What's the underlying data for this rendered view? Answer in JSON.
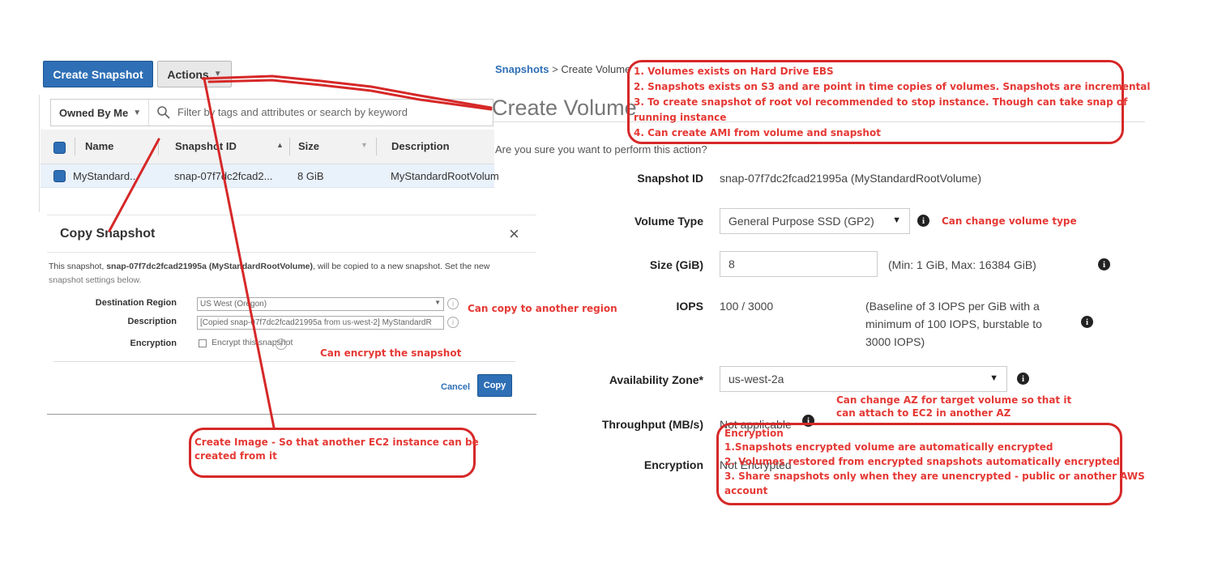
{
  "toolbar": {
    "create_snapshot": "Create Snapshot",
    "actions": "Actions",
    "chevron": "v"
  },
  "filter": {
    "owned_by": "Owned By Me",
    "placeholder": "Filter by tags and attributes or search by keyword"
  },
  "table": {
    "headers": [
      "Name",
      "Snapshot ID",
      "Size",
      "Description"
    ],
    "row": {
      "name": "MyStandard...",
      "snapshot_id": "snap-07f7dc2fcad2...",
      "size": "8 GiB",
      "description": "MyStandardRootVolum"
    }
  },
  "copy_modal": {
    "title": "Copy Snapshot",
    "close": "×",
    "message_prefix": "This snapshot, ",
    "message_bold": "snap-07f7dc2fcad21995a (MyStandardRootVolume)",
    "message_suffix": ", will be copied to a new snapshot. Set the new",
    "message_line2": "snapshot settings below.",
    "destination_label": "Destination Region",
    "destination_value": "US West (Oregon)",
    "description_label": "Description",
    "description_value": "[Copied snap-07f7dc2fcad21995a from us-west-2] MyStandardR",
    "encryption_label": "Encryption",
    "encryption_checkbox": "Encrypt this snapshot",
    "cancel": "Cancel",
    "copy": "Copy"
  },
  "create_volume": {
    "breadcrumb_link": "Snapshots",
    "breadcrumb_sep": ">",
    "breadcrumb_current": "Create Volume",
    "title": "Create Volume",
    "confirm": "Are you sure you want to perform this action?",
    "fields": {
      "snapshot_id_label": "Snapshot ID",
      "snapshot_id_value": "snap-07f7dc2fcad21995a (MyStandardRootVolume)",
      "volume_type_label": "Volume Type",
      "volume_type_value": "General Purpose SSD (GP2)",
      "size_label": "Size (GiB)",
      "size_value": "8",
      "size_hint": "(Min: 1 GiB, Max: 16384 GiB)",
      "iops_label": "IOPS",
      "iops_value": "100 / 3000",
      "iops_hint_1": "(Baseline of 3 IOPS per GiB with a",
      "iops_hint_2": "minimum of 100 IOPS, burstable to",
      "iops_hint_3": "3000 IOPS)",
      "az_label": "Availability Zone*",
      "az_value": "us-west-2a",
      "throughput_label": "Throughput (MB/s)",
      "throughput_value": "Not applicable",
      "encryption_label": "Encryption",
      "encryption_value": "Not Encrypted"
    }
  },
  "annotations": {
    "top_box": [
      "1. Volumes exists on Hard Drive EBS",
      "2. Snapshots exists on S3 and are point in time copies of volumes. Snapshots are incremental",
      "3. To create snapshot of root vol recommended to stop instance. Though can take snap of",
      "running instance",
      "4. Can create AMI from volume and snapshot"
    ],
    "volume_type": "Can change volume type",
    "copy_region": "Can copy to another region",
    "encrypt": "Can encrypt the snapshot",
    "az_1": "Can change AZ for target volume so that it",
    "az_2": "can attach to EC2 in another AZ",
    "create_image_1": "Create Image - So that another EC2 instance can be",
    "create_image_2": "created from it",
    "encryption_box": [
      "Encryption",
      "1.Snapshots encrypted volume are automatically encrypted",
      "2. Volumes restored from encrypted snapshots automatically encrypted",
      "3. Share snapshots only when they are unencrypted - public or another AWS",
      "account"
    ]
  },
  "colors": {
    "annotation": "#e53935",
    "primary_button": "#2e6fb6",
    "link": "#2e6fb6"
  }
}
